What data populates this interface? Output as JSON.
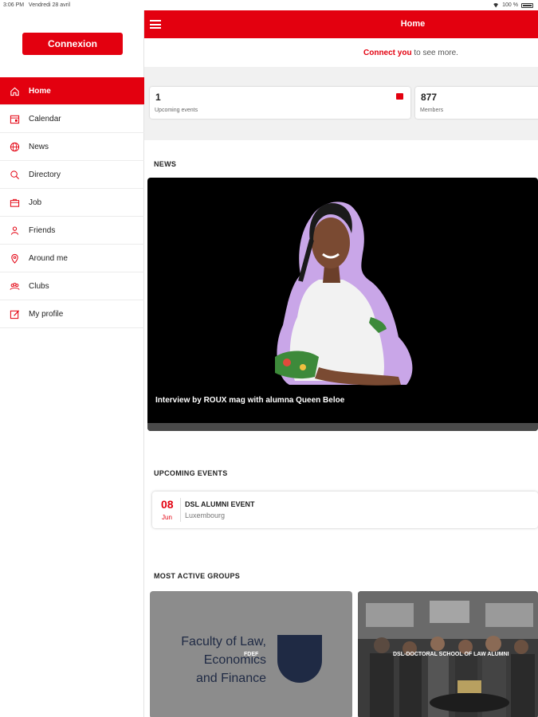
{
  "status_bar": {
    "time": "3:06 PM",
    "date": "Vendredi 28 avril",
    "battery": "100 %"
  },
  "sidebar": {
    "login_label": "Connexion",
    "items": [
      {
        "label": "Home",
        "icon": "home-icon",
        "active": true
      },
      {
        "label": "Calendar",
        "icon": "calendar-icon",
        "active": false
      },
      {
        "label": "News",
        "icon": "globe-icon",
        "active": false
      },
      {
        "label": "Directory",
        "icon": "search-icon",
        "active": false
      },
      {
        "label": "Job",
        "icon": "briefcase-icon",
        "active": false
      },
      {
        "label": "Friends",
        "icon": "friends-icon",
        "active": false
      },
      {
        "label": "Around me",
        "icon": "location-pin-icon",
        "active": false
      },
      {
        "label": "Clubs",
        "icon": "group-icon",
        "active": false
      },
      {
        "label": "My profile",
        "icon": "edit-profile-icon",
        "active": false
      }
    ]
  },
  "header": {
    "title": "Home",
    "menu_icon": "hamburger-icon"
  },
  "connect_banner": {
    "link": "Connect you",
    "rest": " to see more."
  },
  "stats": [
    {
      "value": "1",
      "label": "Upcoming events",
      "icon": "calendar-icon"
    },
    {
      "value": "877",
      "label": "Members"
    }
  ],
  "news": {
    "section_title": "NEWS",
    "caption": "Interview by ROUX mag with alumna Queen Beloe"
  },
  "events": {
    "section_title": "UPCOMING EVENTS",
    "items": [
      {
        "day": "08",
        "month": "Jun",
        "name": "DSL ALUMNI EVENT",
        "place": "Luxembourg"
      }
    ]
  },
  "groups": {
    "section_title": "MOST ACTIVE GROUPS",
    "items": [
      {
        "label": "FDEF",
        "image_text": [
          "Faculty of Law,",
          "Economics",
          "and Finance"
        ]
      },
      {
        "label": "DSL-DOCTORAL SCHOOL OF LAW ALUMNI"
      }
    ]
  },
  "colors": {
    "brand_red": "#e3000f",
    "navy": "#1f2a44"
  }
}
